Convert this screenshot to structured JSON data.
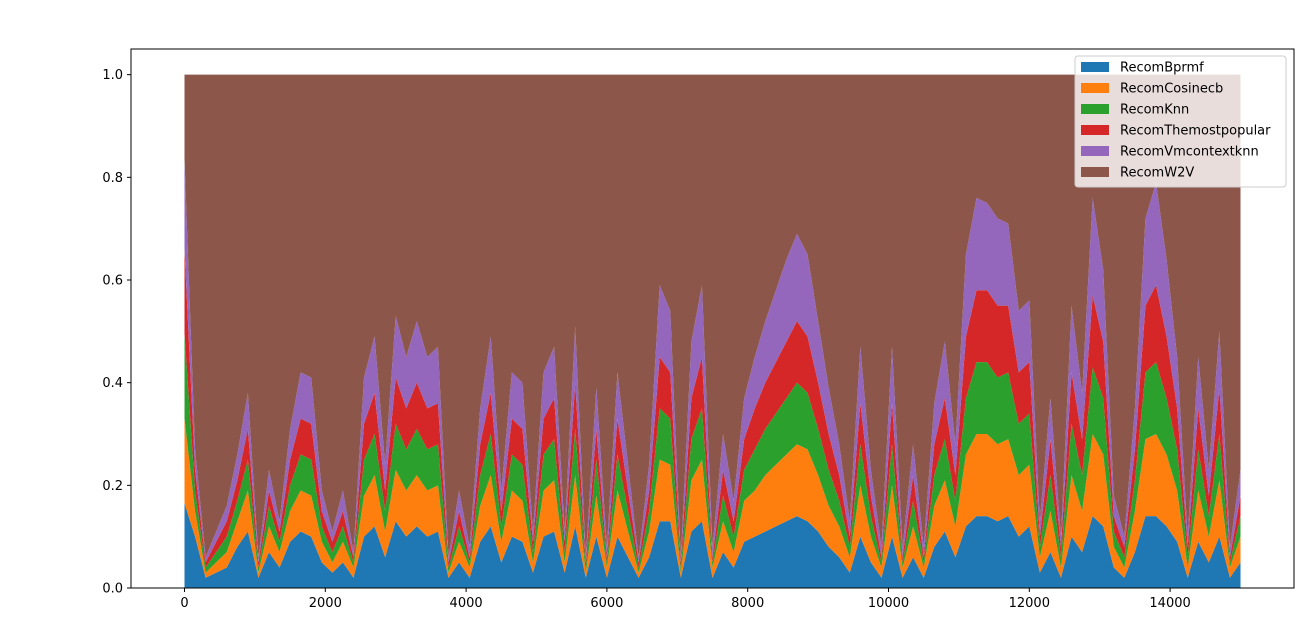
{
  "chart_data": {
    "type": "area",
    "stacked": true,
    "normalized": true,
    "title": "",
    "xlabel": "",
    "ylabel": "",
    "xlim": [
      -760,
      15760
    ],
    "ylim": [
      0.0,
      1.05
    ],
    "x_ticks": [
      0,
      2000,
      4000,
      6000,
      8000,
      10000,
      12000,
      14000
    ],
    "y_ticks": [
      0.0,
      0.2,
      0.4,
      0.6,
      0.8,
      1.0
    ],
    "x_tick_labels": [
      "0",
      "2000",
      "4000",
      "6000",
      "8000",
      "10000",
      "12000",
      "14000"
    ],
    "y_tick_labels": [
      "0.0",
      "0.2",
      "0.4",
      "0.6",
      "0.8",
      "1.0"
    ],
    "grid": false,
    "legend_position": "upper right",
    "x": [
      0,
      150,
      300,
      450,
      600,
      750,
      900,
      1050,
      1200,
      1350,
      1500,
      1650,
      1800,
      1950,
      2100,
      2250,
      2400,
      2550,
      2700,
      2850,
      3000,
      3150,
      3300,
      3450,
      3600,
      3750,
      3900,
      4050,
      4200,
      4350,
      4500,
      4650,
      4800,
      4950,
      5100,
      5250,
      5400,
      5550,
      5700,
      5850,
      6000,
      6150,
      6300,
      6450,
      6600,
      6750,
      6900,
      7050,
      7200,
      7350,
      7500,
      7650,
      7800,
      7950,
      8100,
      8250,
      8400,
      8550,
      8700,
      8850,
      9000,
      9150,
      9300,
      9450,
      9600,
      9750,
      9900,
      10050,
      10200,
      10350,
      10500,
      10650,
      10800,
      10950,
      11100,
      11250,
      11400,
      11550,
      11700,
      11850,
      12000,
      12150,
      12300,
      12450,
      12600,
      12750,
      12900,
      13050,
      13200,
      13350,
      13500,
      13650,
      13800,
      13950,
      14100,
      14250,
      14400,
      14550,
      14700,
      14850,
      15000
    ],
    "series": [
      {
        "name": "RecomBprmf",
        "color": "#1f77b4",
        "values": [
          0.165,
          0.1,
          0.02,
          0.03,
          0.04,
          0.08,
          0.11,
          0.02,
          0.07,
          0.04,
          0.09,
          0.11,
          0.1,
          0.05,
          0.03,
          0.05,
          0.02,
          0.1,
          0.12,
          0.06,
          0.13,
          0.1,
          0.12,
          0.1,
          0.11,
          0.02,
          0.05,
          0.02,
          0.09,
          0.12,
          0.05,
          0.1,
          0.09,
          0.03,
          0.1,
          0.11,
          0.03,
          0.12,
          0.02,
          0.1,
          0.02,
          0.1,
          0.06,
          0.02,
          0.06,
          0.13,
          0.13,
          0.02,
          0.11,
          0.13,
          0.02,
          0.07,
          0.04,
          0.09,
          0.1,
          0.11,
          0.12,
          0.13,
          0.14,
          0.13,
          0.11,
          0.08,
          0.06,
          0.03,
          0.1,
          0.05,
          0.02,
          0.1,
          0.02,
          0.06,
          0.02,
          0.08,
          0.11,
          0.06,
          0.12,
          0.14,
          0.14,
          0.13,
          0.14,
          0.1,
          0.12,
          0.03,
          0.07,
          0.02,
          0.1,
          0.07,
          0.14,
          0.12,
          0.04,
          0.02,
          0.07,
          0.14,
          0.14,
          0.12,
          0.09,
          0.02,
          0.09,
          0.05,
          0.1,
          0.02,
          0.05
        ]
      },
      {
        "name": "RecomCosinecb",
        "color": "#ff7f0e",
        "values": [
          0.165,
          0.05,
          0.01,
          0.02,
          0.03,
          0.05,
          0.08,
          0.01,
          0.05,
          0.03,
          0.06,
          0.08,
          0.08,
          0.04,
          0.02,
          0.04,
          0.02,
          0.08,
          0.1,
          0.05,
          0.1,
          0.09,
          0.1,
          0.09,
          0.09,
          0.01,
          0.04,
          0.02,
          0.07,
          0.1,
          0.04,
          0.09,
          0.08,
          0.02,
          0.09,
          0.1,
          0.02,
          0.1,
          0.01,
          0.08,
          0.02,
          0.09,
          0.05,
          0.01,
          0.05,
          0.12,
          0.11,
          0.01,
          0.1,
          0.12,
          0.02,
          0.06,
          0.03,
          0.08,
          0.09,
          0.11,
          0.12,
          0.13,
          0.14,
          0.14,
          0.11,
          0.08,
          0.06,
          0.03,
          0.1,
          0.05,
          0.02,
          0.1,
          0.02,
          0.06,
          0.02,
          0.08,
          0.1,
          0.06,
          0.14,
          0.16,
          0.16,
          0.15,
          0.15,
          0.12,
          0.12,
          0.03,
          0.08,
          0.02,
          0.12,
          0.08,
          0.16,
          0.14,
          0.04,
          0.02,
          0.08,
          0.15,
          0.16,
          0.14,
          0.1,
          0.02,
          0.1,
          0.05,
          0.11,
          0.02,
          0.05
        ]
      },
      {
        "name": "RecomKnn",
        "color": "#2ca02c",
        "values": [
          0.165,
          0.04,
          0.01,
          0.02,
          0.03,
          0.04,
          0.06,
          0.01,
          0.04,
          0.02,
          0.05,
          0.07,
          0.07,
          0.03,
          0.02,
          0.03,
          0.01,
          0.07,
          0.08,
          0.04,
          0.09,
          0.08,
          0.09,
          0.08,
          0.08,
          0.01,
          0.03,
          0.01,
          0.06,
          0.08,
          0.03,
          0.07,
          0.07,
          0.02,
          0.07,
          0.08,
          0.02,
          0.09,
          0.01,
          0.07,
          0.01,
          0.07,
          0.04,
          0.01,
          0.04,
          0.1,
          0.09,
          0.01,
          0.08,
          0.1,
          0.01,
          0.05,
          0.03,
          0.06,
          0.08,
          0.09,
          0.1,
          0.11,
          0.12,
          0.11,
          0.09,
          0.07,
          0.05,
          0.02,
          0.08,
          0.04,
          0.01,
          0.08,
          0.01,
          0.05,
          0.01,
          0.06,
          0.08,
          0.05,
          0.11,
          0.14,
          0.14,
          0.13,
          0.13,
          0.1,
          0.1,
          0.02,
          0.07,
          0.02,
          0.1,
          0.07,
          0.13,
          0.11,
          0.03,
          0.02,
          0.06,
          0.13,
          0.14,
          0.11,
          0.08,
          0.02,
          0.08,
          0.04,
          0.09,
          0.01,
          0.04
        ]
      },
      {
        "name": "RecomThemostpopular",
        "color": "#d62728",
        "values": [
          0.165,
          0.04,
          0.01,
          0.02,
          0.03,
          0.04,
          0.06,
          0.01,
          0.03,
          0.02,
          0.05,
          0.07,
          0.07,
          0.03,
          0.02,
          0.03,
          0.01,
          0.07,
          0.08,
          0.04,
          0.09,
          0.08,
          0.09,
          0.08,
          0.08,
          0.01,
          0.03,
          0.01,
          0.06,
          0.08,
          0.03,
          0.07,
          0.07,
          0.02,
          0.07,
          0.08,
          0.02,
          0.09,
          0.01,
          0.06,
          0.01,
          0.07,
          0.04,
          0.01,
          0.04,
          0.1,
          0.09,
          0.01,
          0.08,
          0.1,
          0.01,
          0.05,
          0.03,
          0.06,
          0.08,
          0.09,
          0.1,
          0.11,
          0.12,
          0.11,
          0.09,
          0.07,
          0.05,
          0.02,
          0.08,
          0.04,
          0.01,
          0.08,
          0.01,
          0.05,
          0.01,
          0.06,
          0.08,
          0.05,
          0.12,
          0.14,
          0.14,
          0.14,
          0.13,
          0.1,
          0.1,
          0.02,
          0.07,
          0.02,
          0.1,
          0.07,
          0.14,
          0.11,
          0.03,
          0.02,
          0.06,
          0.13,
          0.15,
          0.12,
          0.08,
          0.02,
          0.08,
          0.04,
          0.09,
          0.01,
          0.04
        ]
      },
      {
        "name": "RecomVmcontextknn",
        "color": "#9467bd",
        "values": [
          0.175,
          0.04,
          0.01,
          0.02,
          0.03,
          0.05,
          0.07,
          0.01,
          0.04,
          0.02,
          0.06,
          0.09,
          0.09,
          0.04,
          0.02,
          0.04,
          0.01,
          0.09,
          0.11,
          0.05,
          0.12,
          0.1,
          0.12,
          0.1,
          0.11,
          0.01,
          0.04,
          0.02,
          0.07,
          0.11,
          0.04,
          0.09,
          0.09,
          0.02,
          0.09,
          0.1,
          0.02,
          0.11,
          0.01,
          0.08,
          0.02,
          0.09,
          0.05,
          0.01,
          0.05,
          0.14,
          0.12,
          0.01,
          0.11,
          0.14,
          0.02,
          0.07,
          0.04,
          0.08,
          0.1,
          0.12,
          0.14,
          0.16,
          0.17,
          0.16,
          0.12,
          0.09,
          0.06,
          0.03,
          0.11,
          0.05,
          0.02,
          0.11,
          0.02,
          0.06,
          0.02,
          0.08,
          0.11,
          0.06,
          0.16,
          0.18,
          0.17,
          0.17,
          0.16,
          0.12,
          0.12,
          0.03,
          0.08,
          0.02,
          0.13,
          0.09,
          0.19,
          0.14,
          0.04,
          0.02,
          0.08,
          0.17,
          0.2,
          0.15,
          0.1,
          0.02,
          0.1,
          0.05,
          0.11,
          0.02,
          0.05
        ]
      },
      {
        "name": "RecomW2V",
        "color": "#8c564b",
        "values": [
          0.165,
          0.73,
          0.94,
          0.89,
          0.84,
          0.74,
          0.62,
          0.94,
          0.77,
          0.87,
          0.69,
          0.58,
          0.59,
          0.81,
          0.89,
          0.81,
          0.93,
          0.59,
          0.51,
          0.76,
          0.47,
          0.55,
          0.48,
          0.55,
          0.53,
          0.94,
          0.81,
          0.92,
          0.65,
          0.51,
          0.81,
          0.58,
          0.6,
          0.89,
          0.58,
          0.53,
          0.89,
          0.49,
          0.94,
          0.61,
          0.92,
          0.58,
          0.76,
          0.94,
          0.76,
          0.41,
          0.46,
          0.94,
          0.52,
          0.41,
          0.92,
          0.7,
          0.83,
          0.63,
          0.55,
          0.48,
          0.42,
          0.36,
          0.31,
          0.35,
          0.48,
          0.61,
          0.72,
          0.87,
          0.53,
          0.77,
          0.92,
          0.53,
          0.92,
          0.72,
          0.92,
          0.64,
          0.52,
          0.72,
          0.35,
          0.24,
          0.25,
          0.28,
          0.29,
          0.46,
          0.44,
          0.87,
          0.63,
          0.9,
          0.45,
          0.62,
          0.24,
          0.38,
          0.82,
          0.9,
          0.65,
          0.28,
          0.21,
          0.36,
          0.55,
          0.9,
          0.55,
          0.77,
          0.5,
          0.92,
          0.77
        ]
      }
    ]
  }
}
